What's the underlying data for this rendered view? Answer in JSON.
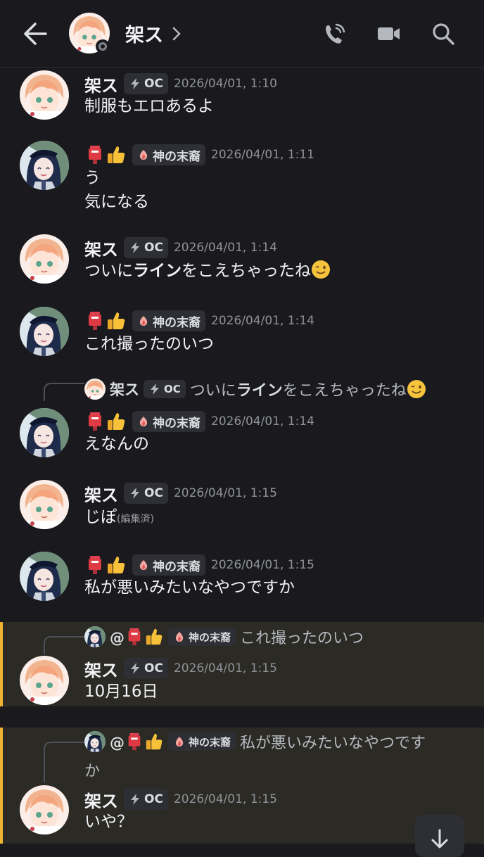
{
  "header": {
    "title": "架ス",
    "icons": [
      "back-arrow-icon",
      "phone-icon",
      "video-camera-icon",
      "search-icon"
    ]
  },
  "users": {
    "kasu": {
      "name": "架ス",
      "tag": "OC"
    },
    "kami": {
      "tag": "神の末裔",
      "mention": "@"
    }
  },
  "messages": [
    {
      "time": "2026/04/01, 1:10",
      "text": "制服もエロあるよ"
    },
    {
      "time": "2026/04/01, 1:11",
      "line1": "う",
      "line2": "気になる"
    },
    {
      "time": "2026/04/01, 1:14",
      "pre": "ついに",
      "bold": "ライン",
      "post": "をこえちゃったね"
    },
    {
      "time": "2026/04/01, 1:14",
      "text": "これ撮ったのいつ"
    },
    {
      "time": "2026/04/01, 1:14",
      "text": "えなんの",
      "reply": {
        "pre": "ついに",
        "bold": "ライン",
        "post": "をこえちゃったね"
      }
    },
    {
      "time": "2026/04/01, 1:15",
      "text": "じぽ",
      "edited": "(編集済)"
    },
    {
      "time": "2026/04/01, 1:15",
      "text": "私が悪いみたいなやつですか"
    },
    {
      "time": "2026/04/01, 1:15",
      "text": "10月16日",
      "reply_text": "これ撮ったのいつ"
    },
    {
      "time": "2026/04/01, 1:15",
      "text": "いや？",
      "reply_text_1": "私が悪いみたいなやつです",
      "reply_text_2": "か"
    }
  ],
  "colors": {
    "background": "#1a1a1e",
    "highlight": "#2b2a25",
    "highlight_bar": "#f0b232",
    "timestamp": "#8e9297"
  }
}
